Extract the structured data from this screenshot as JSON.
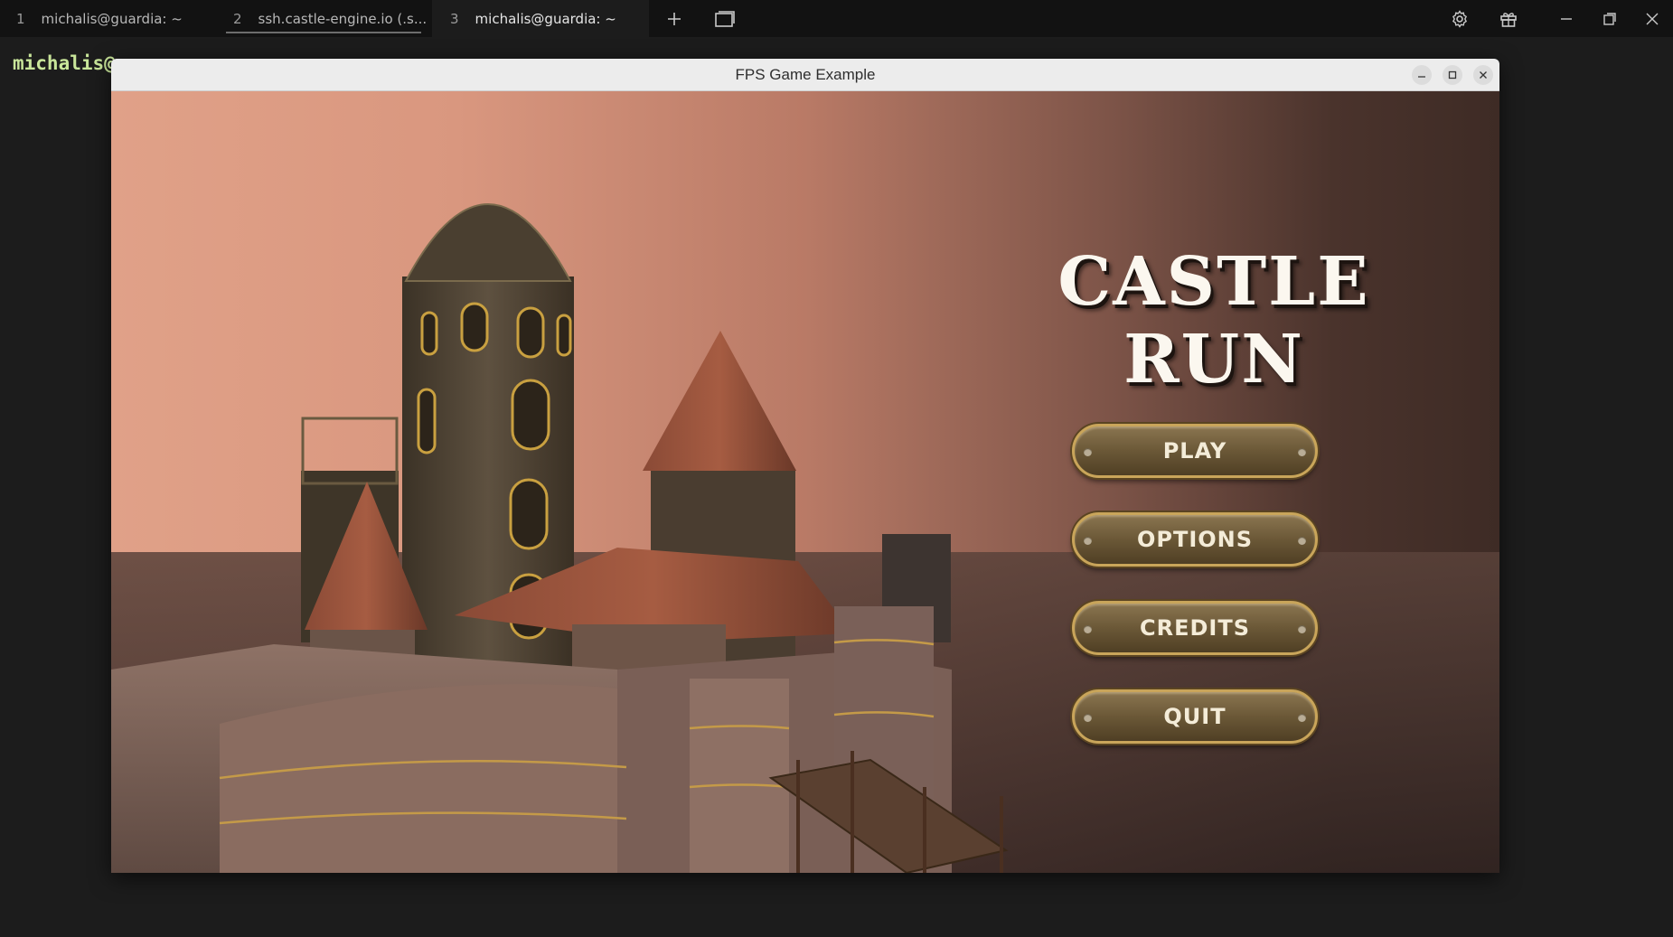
{
  "terminal": {
    "tabs": [
      {
        "num": "1",
        "label": "michalis@guardia: ~"
      },
      {
        "num": "2",
        "label": "ssh.castle-engine.io (.s..."
      },
      {
        "num": "3",
        "label": "michalis@guardia: ~"
      }
    ],
    "prompt_text": "michalis@",
    "icons": [
      "add-tab-icon",
      "tab-overview-icon",
      "gear-icon",
      "gift-icon",
      "minimize-icon",
      "restore-icon",
      "close-icon"
    ]
  },
  "window": {
    "title": "FPS Game Example",
    "controls": [
      "minimize-icon",
      "maximize-icon",
      "close-icon"
    ]
  },
  "game": {
    "title": "CASTLE RUN",
    "menu": [
      {
        "label": "PLAY"
      },
      {
        "label": "OPTIONS"
      },
      {
        "label": "CREDITS"
      },
      {
        "label": "QUIT"
      }
    ],
    "colors": {
      "button_border": "#c9a55a",
      "button_fill": "#6b5837",
      "sky_left": "#e0a188",
      "sky_right": "#3e2b25"
    }
  }
}
